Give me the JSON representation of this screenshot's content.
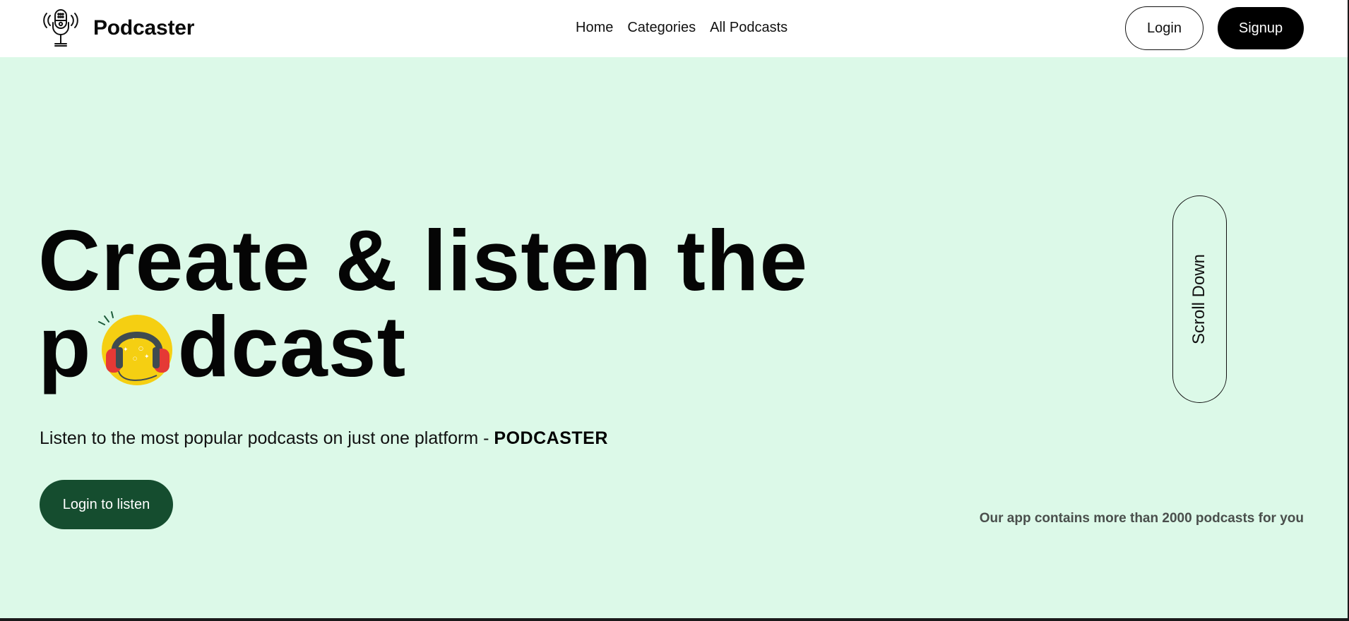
{
  "navbar": {
    "brand": "Podcaster",
    "links": [
      "Home",
      "Categories",
      "All Podcasts"
    ],
    "login_label": "Login",
    "signup_label": "Signup"
  },
  "hero": {
    "title_line1": "Create & listen the",
    "title_line2_before": "p",
    "title_line2_after": "dcast",
    "subtitle_text": "Listen to the most popular podcasts on just one platform - ",
    "subtitle_brand": "PODCASTER",
    "cta_label": "Login to listen",
    "scroll_label": "Scroll Down",
    "stat_text": "Our app contains more than 2000 podcasts for you"
  },
  "icons": {
    "logo": "microphone-icon",
    "title_o": "headphones-icon"
  },
  "colors": {
    "hero_background": "#dcf9e8",
    "cta_background": "#154d2f",
    "signup_background": "#000000",
    "headphones_circle": "#f5cf12"
  }
}
